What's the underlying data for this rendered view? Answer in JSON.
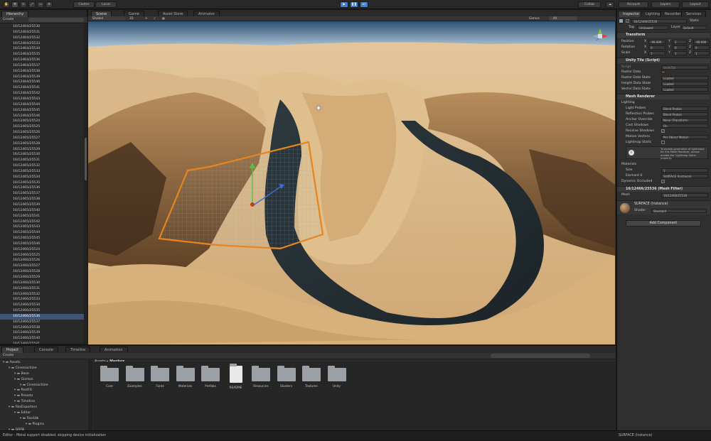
{
  "toolbar": {
    "pivot": "Center",
    "space": "Local",
    "collab": "Collab",
    "account": "Account",
    "layers": "Layers",
    "layout": "Layout",
    "accent": "#3c7fd0"
  },
  "hierarchy": {
    "tab": "Hierarchy",
    "create": "Create",
    "rows": [
      "16/12464/25530",
      "16/12464/25531",
      "16/12464/25532",
      "16/12464/25533",
      "16/12464/25534",
      "16/12464/25535",
      "16/12464/25536",
      "16/12464/25537",
      "16/12464/25538",
      "16/12464/25539",
      "16/12464/25540",
      "16/12464/25541",
      "16/12464/25542",
      "16/12464/25543",
      "16/12464/25544",
      "16/12464/25545",
      "16/12464/25546",
      "16/12465/25524",
      "16/12465/25525",
      "16/12465/25526",
      "16/12465/25527",
      "16/12465/25528",
      "16/12465/25529",
      "16/12465/25530",
      "16/12465/25531",
      "16/12465/25532",
      "16/12465/25533",
      "16/12465/25534",
      "16/12465/25535",
      "16/12465/25536",
      "16/12465/25537",
      "16/12465/25538",
      "16/12465/25539",
      "16/12465/25540",
      "16/12465/25541",
      "16/12465/25542",
      "16/12465/25543",
      "16/12465/25544",
      "16/12465/25545",
      "16/12465/25546",
      "16/12466/25524",
      "16/12466/25525",
      "16/12466/25526",
      "16/12466/25527",
      "16/12466/25528",
      "16/12466/25529",
      "16/12466/25530",
      "16/12466/25531",
      "16/12466/25532",
      "16/12466/25533",
      "16/12466/25534",
      "16/12466/25535",
      "16/12466/25536",
      "16/12466/25537",
      "16/12466/25538",
      "16/12466/25539",
      "16/12466/25540",
      "16/12466/25541",
      "16/12466/25542",
      "16/12466/25543"
    ],
    "selected_index": 52
  },
  "scene_tabs": {
    "scene": "Scene",
    "game": "Game",
    "asset_store": "Asset Store",
    "animator": "Animator"
  },
  "scene_toolbar": {
    "shading": "Shaded",
    "mode2d": "2D",
    "gizmos": "Gizmos",
    "search": "All"
  },
  "inspector": {
    "tabs": {
      "inspector": "Inspector",
      "lighting": "Lighting",
      "recorder": "Recorder",
      "services": "Services"
    },
    "object_name": "16/12466/25536",
    "static": "Static",
    "tag_label": "Tag",
    "tag_value": "Untagged",
    "layer_label": "Layer",
    "layer_value": "Default",
    "transform": {
      "title": "Transform",
      "position_label": "Position",
      "pos_x": "-99.999",
      "pos_y": "2",
      "pos_z": "-99.999",
      "rotation_label": "Rotation",
      "rot_x": "0",
      "rot_y": "0",
      "rot_z": "0",
      "scale_label": "Scale",
      "sc_x": "1",
      "sc_y": "1",
      "sc_z": "1"
    },
    "tile_script": {
      "title": "Unity Tile (Script)",
      "script_label": "Script",
      "script_value": "UnityTile",
      "raster_data": "Raster Data",
      "raster_state_label": "Raster Data State",
      "raster_state": "Loaded",
      "height_state_label": "Height Data State",
      "height_state": "Loaded",
      "vector_state_label": "Vector Data State",
      "vector_state": "Loaded"
    },
    "mesh_renderer": {
      "title": "Mesh Renderer",
      "lighting": "Lighting",
      "light_probes_label": "Light Probes",
      "light_probes": "Blend Probes",
      "reflection_probes_label": "Reflection Probes",
      "reflection_probes": "Blend Probes",
      "anchor_label": "Anchor Override",
      "anchor": "None (Transform)",
      "cast_label": "Cast Shadows",
      "cast": "On",
      "receive_label": "Receive Shadows",
      "motion_label": "Motion Vectors",
      "motion": "Per Object Motion",
      "lightmap_label": "Lightmap Static",
      "info": "To enable generation of lightmaps for this Mesh Renderer, please enable the 'Lightmap Static' property.",
      "materials": "Materials",
      "size_label": "Size",
      "size": "1",
      "element_label": "Element 0",
      "element": "SURFACE (Instance)",
      "dyn_label": "Dynamic Occluded"
    },
    "mesh_filter": {
      "title": "16/12466/25536 (Mesh Filter)",
      "mesh_label": "Mesh",
      "mesh": "16/12466/25536"
    },
    "material": {
      "title": "SURFACE (Instance)",
      "shader_label": "Shader",
      "shader": "Standard"
    },
    "add_component": "Add Component"
  },
  "project": {
    "tabs": {
      "project": "Project",
      "console": "Console",
      "timeline": "Timeline",
      "animation": "Animation"
    },
    "create": "Create",
    "tree": [
      {
        "label": "Assets",
        "depth": 0
      },
      {
        "label": "Cinemachine",
        "depth": 1
      },
      {
        "label": "Base",
        "depth": 2
      },
      {
        "label": "Gizmos",
        "depth": 2
      },
      {
        "label": "Cinemachine",
        "depth": 3
      },
      {
        "label": "PostFX",
        "depth": 2
      },
      {
        "label": "Presets",
        "depth": 2
      },
      {
        "label": "Timeline",
        "depth": 2
      },
      {
        "label": "FbxExporters",
        "depth": 1
      },
      {
        "label": "Editor",
        "depth": 2
      },
      {
        "label": "FbxSdk",
        "depth": 3
      },
      {
        "label": "Plugins",
        "depth": 4
      },
      {
        "label": "GRFB",
        "depth": 1
      },
      {
        "label": "Gizmos",
        "depth": 1
      }
    ],
    "breadcrumb": [
      "Assets",
      "Mapbox"
    ],
    "items": [
      "Core",
      "Examples",
      "Fonts",
      "Materials",
      "Prefabs",
      "README",
      "Resources",
      "Shaders",
      "Textures",
      "Unity"
    ]
  },
  "status": {
    "message": "Editor - Metal support disabled, skipping device initialization",
    "selection": "SURFACE (Instance)"
  }
}
